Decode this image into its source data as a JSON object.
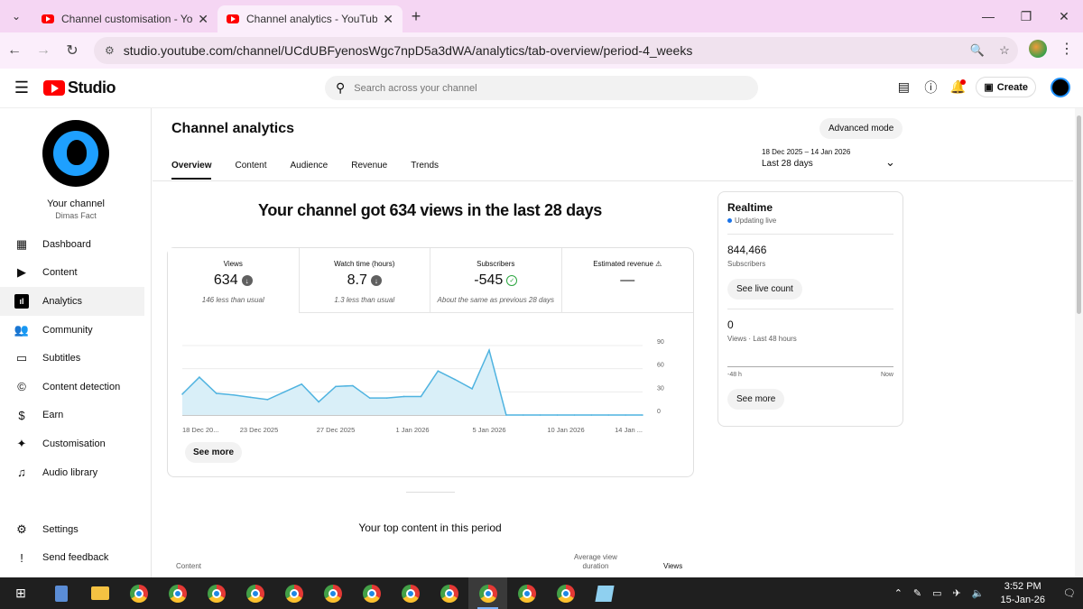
{
  "browser": {
    "tabs": [
      {
        "title": "Channel customisation - YouTube Studio",
        "active": false
      },
      {
        "title": "Channel analytics - YouTube Studio",
        "active": true
      }
    ],
    "url": "studio.youtube.com/channel/UCdUBFyenosWgc7npD5a3dWA/analytics/tab-overview/period-4_weeks"
  },
  "header": {
    "logo_text": "Studio",
    "search_placeholder": "Search across your channel",
    "create_label": "Create"
  },
  "sidebar": {
    "channel_label": "Your channel",
    "channel_name": "Dimas Fact",
    "items": [
      {
        "label": "Dashboard",
        "icon": "dashboard-icon",
        "active": false
      },
      {
        "label": "Content",
        "icon": "content-icon",
        "active": false
      },
      {
        "label": "Analytics",
        "icon": "analytics-icon",
        "active": true
      },
      {
        "label": "Community",
        "icon": "community-icon",
        "active": false
      },
      {
        "label": "Subtitles",
        "icon": "subtitles-icon",
        "active": false
      },
      {
        "label": "Content detection",
        "icon": "copyright-icon",
        "active": false
      },
      {
        "label": "Earn",
        "icon": "dollar-icon",
        "active": false
      },
      {
        "label": "Customisation",
        "icon": "magic-wand-icon",
        "active": false
      },
      {
        "label": "Audio library",
        "icon": "audio-library-icon",
        "active": false
      }
    ],
    "bottom_items": [
      {
        "label": "Settings",
        "icon": "gear-icon"
      },
      {
        "label": "Send feedback",
        "icon": "feedback-icon"
      }
    ]
  },
  "main": {
    "title": "Channel analytics",
    "advanced_mode": "Advanced mode",
    "tabs": [
      "Overview",
      "Content",
      "Audience",
      "Revenue",
      "Trends"
    ],
    "active_tab": "Overview",
    "date_range": "18 Dec 2025 – 14 Jan 2026",
    "date_label": "Last 28 days",
    "headline": "Your channel got 634 views in the last 28 days",
    "metrics": [
      {
        "label": "Views",
        "value": "634",
        "status": "down",
        "sub": "146 less than usual"
      },
      {
        "label": "Watch time (hours)",
        "value": "8.7",
        "status": "down",
        "sub": "1.3 less than usual"
      },
      {
        "label": "Subscribers",
        "value": "-545",
        "status": "ok",
        "sub": "About the same as previous 28 days"
      },
      {
        "label": "Estimated revenue",
        "value": "—",
        "status": "warning",
        "sub": ""
      }
    ],
    "see_more": "See more",
    "top_content_title": "Your top content in this period",
    "table_headers": {
      "content": "Content",
      "avg_view_duration": "Average view duration",
      "views": "Views"
    }
  },
  "realtime": {
    "title": "Realtime",
    "status": "Updating live",
    "subscribers_value": "844,466",
    "subscribers_label": "Subscribers",
    "live_count_button": "See live count",
    "views_value": "0",
    "views_label": "Views · Last 48 hours",
    "axis_left": "-48 h",
    "axis_right": "Now",
    "see_more": "See more"
  },
  "chart_data": {
    "type": "area",
    "x_tick_labels": [
      "18 Dec 20...",
      "23 Dec 2025",
      "27 Dec 2025",
      "1 Jan 2026",
      "5 Jan 2026",
      "10 Jan 2026",
      "14 Jan ..."
    ],
    "y_ticks": [
      0,
      30,
      60,
      90
    ],
    "ylim": [
      0,
      90
    ],
    "x": [
      "18 Dec",
      "19 Dec",
      "20 Dec",
      "21 Dec",
      "22 Dec",
      "23 Dec",
      "24 Dec",
      "25 Dec",
      "26 Dec",
      "27 Dec",
      "28 Dec",
      "29 Dec",
      "30 Dec",
      "31 Dec",
      "1 Jan",
      "2 Jan",
      "3 Jan",
      "4 Jan",
      "5 Jan",
      "6 Jan",
      "7 Jan",
      "8 Jan",
      "9 Jan",
      "10 Jan",
      "11 Jan",
      "12 Jan",
      "13 Jan",
      "14 Jan"
    ],
    "values": [
      27,
      49,
      28,
      26,
      23,
      20,
      30,
      40,
      17,
      37,
      38,
      22,
      22,
      24,
      24,
      57,
      46,
      34,
      84,
      0,
      0,
      0,
      0,
      0,
      0,
      0,
      0,
      0
    ],
    "colors": {
      "line": "#4fb3e0",
      "fill": "#d9eff8"
    }
  },
  "taskbar": {
    "time": "3:52 PM",
    "date": "15-Jan-26"
  }
}
